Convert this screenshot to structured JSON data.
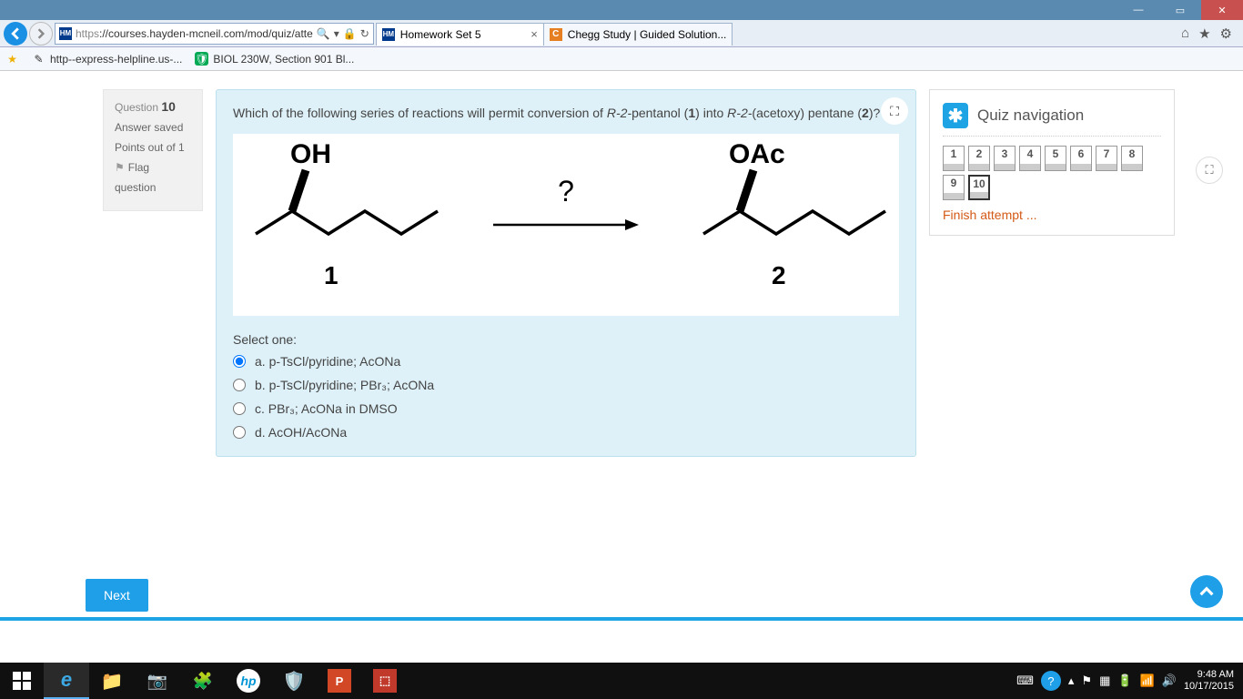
{
  "window": {
    "min": "—",
    "max": "▭",
    "close": "✕"
  },
  "browser": {
    "url_scheme": "https",
    "url_rest": "://courses.hayden-mcneil.com/mod/quiz/atte",
    "search_glyph": "🔍",
    "dropdown_glyph": "▾",
    "lock_glyph": "🔒",
    "refresh_glyph": "↻",
    "tabs": [
      {
        "favicon": "HM",
        "title": "Homework Set 5",
        "active": true
      },
      {
        "favicon": "C",
        "title": "Chegg Study | Guided Solution..."
      }
    ],
    "right_icons": {
      "home": "⌂",
      "star": "★",
      "gear": "⚙"
    }
  },
  "favorites": [
    {
      "icon": "⚡",
      "label": ""
    },
    {
      "icon": "✎",
      "label": "http--express-helpline.us-..."
    },
    {
      "icon": "🛡",
      "label": "BIOL 230W, Section 901 Bl..."
    }
  ],
  "question_meta": {
    "label": "Question",
    "number": "10",
    "status": "Answer saved",
    "points": "Points out of 1",
    "flag_label": "Flag",
    "flag_sub": "question"
  },
  "question": {
    "text_pre": "Which of the following series of reactions will permit conversion of ",
    "mol1": "R-2-",
    "mol1b": "pentanol (",
    "mol1n": "1",
    "mid": ") into ",
    "mol2": "R-2-",
    "mol2b": "(acetoxy) pentane (",
    "mol2n": "2",
    "end": ")?",
    "struct1_group": "OH",
    "struct2_group": "OAc",
    "struct1_num": "1",
    "struct2_num": "2",
    "arrow_q": "?",
    "select_one": "Select one:",
    "options": [
      {
        "key": "a",
        "label": "a. p-TsCl/pyridine; AcONa",
        "checked": true
      },
      {
        "key": "b",
        "label": "b. p-TsCl/pyridine; PBr₃; AcONa",
        "checked": false
      },
      {
        "key": "c",
        "label": "c. PBr₃; AcONa in DMSO",
        "checked": false
      },
      {
        "key": "d",
        "label": "d. AcOH/AcONa",
        "checked": false
      }
    ]
  },
  "quiz_nav": {
    "title": "Quiz navigation",
    "numbers": [
      "1",
      "2",
      "3",
      "4",
      "5",
      "6",
      "7",
      "8",
      "9",
      "10"
    ],
    "current": "10",
    "finish": "Finish attempt ..."
  },
  "next_button": "Next",
  "taskbar": {
    "time": "9:48 AM",
    "date": "10/17/2015"
  }
}
